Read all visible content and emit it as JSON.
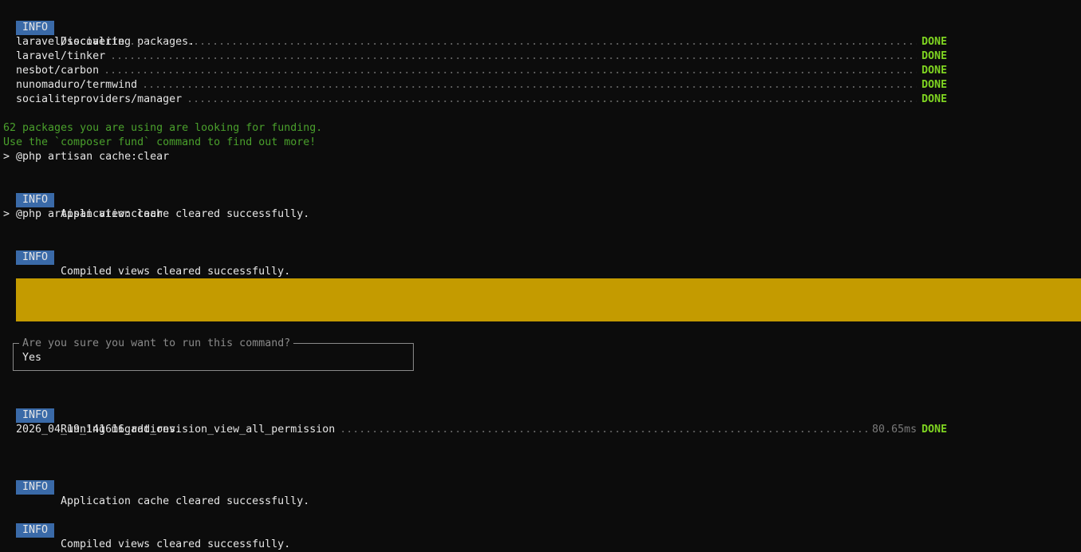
{
  "info_label": "INFO",
  "blocks": {
    "discovering": "Discovering packages.",
    "cache_cleared_1": "Application cache cleared successfully.",
    "views_cleared_1": "Compiled views cleared successfully.",
    "running_migrations": "Running migrations.",
    "cache_cleared_2": "Application cache cleared successfully.",
    "views_cleared_2": "Compiled views cleared successfully."
  },
  "packages": [
    {
      "name": "laravel/socialite",
      "status": "DONE"
    },
    {
      "name": "laravel/tinker",
      "status": "DONE"
    },
    {
      "name": "nesbot/carbon",
      "status": "DONE"
    },
    {
      "name": "nunomaduro/termwind",
      "status": "DONE"
    },
    {
      "name": "socialiteproviders/manager",
      "status": "DONE"
    }
  ],
  "funding": {
    "line1": "62 packages you are using are looking for funding.",
    "line2": "Use the `composer fund` command to find out more!"
  },
  "commands": {
    "cache_clear": "> @php artisan cache:clear",
    "view_clear": "> @php artisan view:clear"
  },
  "colors": {
    "info_badge": "#3a6aa8",
    "done": "#7ed321",
    "funding_text": "#4aa02c",
    "warning_bar": "#c49b00",
    "background": "#0c0c0c"
  },
  "prompt": {
    "question": "Are you sure you want to run this command?",
    "answer": "Yes"
  },
  "migration": {
    "name": "2026_04_19_141616_add_revision_view_all_permission",
    "time": "80.65ms",
    "status": "DONE"
  }
}
